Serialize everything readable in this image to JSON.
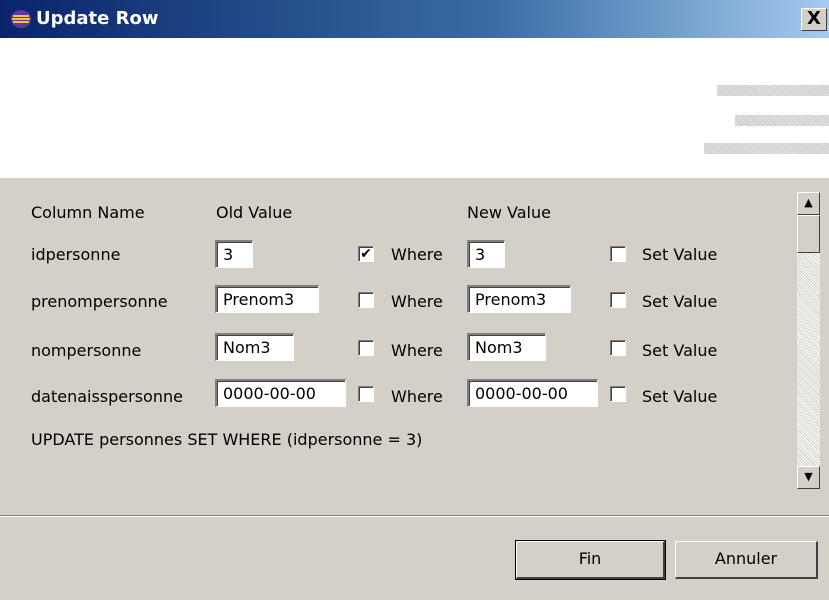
{
  "window": {
    "title": "Update Row",
    "close_label": "X"
  },
  "columns": {
    "name": "Column Name",
    "old": "Old Value",
    "new": "New Value"
  },
  "rows": [
    {
      "name": "idpersonne",
      "old": "3",
      "where_checked": true,
      "where_label": "Where",
      "new": "3",
      "set_checked": false,
      "set_label": "Set Value"
    },
    {
      "name": "prenompersonne",
      "old": "Prenom3",
      "where_checked": false,
      "where_label": "Where",
      "new": "Prenom3",
      "set_checked": false,
      "set_label": "Set Value"
    },
    {
      "name": "nompersonne",
      "old": "Nom3",
      "where_checked": false,
      "where_label": "Where",
      "new": "Nom3",
      "set_checked": false,
      "set_label": "Set Value"
    },
    {
      "name": "datenaisspersonne",
      "old": "0000-00-00",
      "where_checked": false,
      "where_label": "Where",
      "new": "0000-00-00",
      "set_checked": false,
      "set_label": "Set Value"
    }
  ],
  "sql": "UPDATE personnes SET  WHERE (idpersonne = 3)",
  "buttons": {
    "finish_label": "Fin",
    "cancel_label": "Annuler"
  },
  "check_glyph": "✔"
}
